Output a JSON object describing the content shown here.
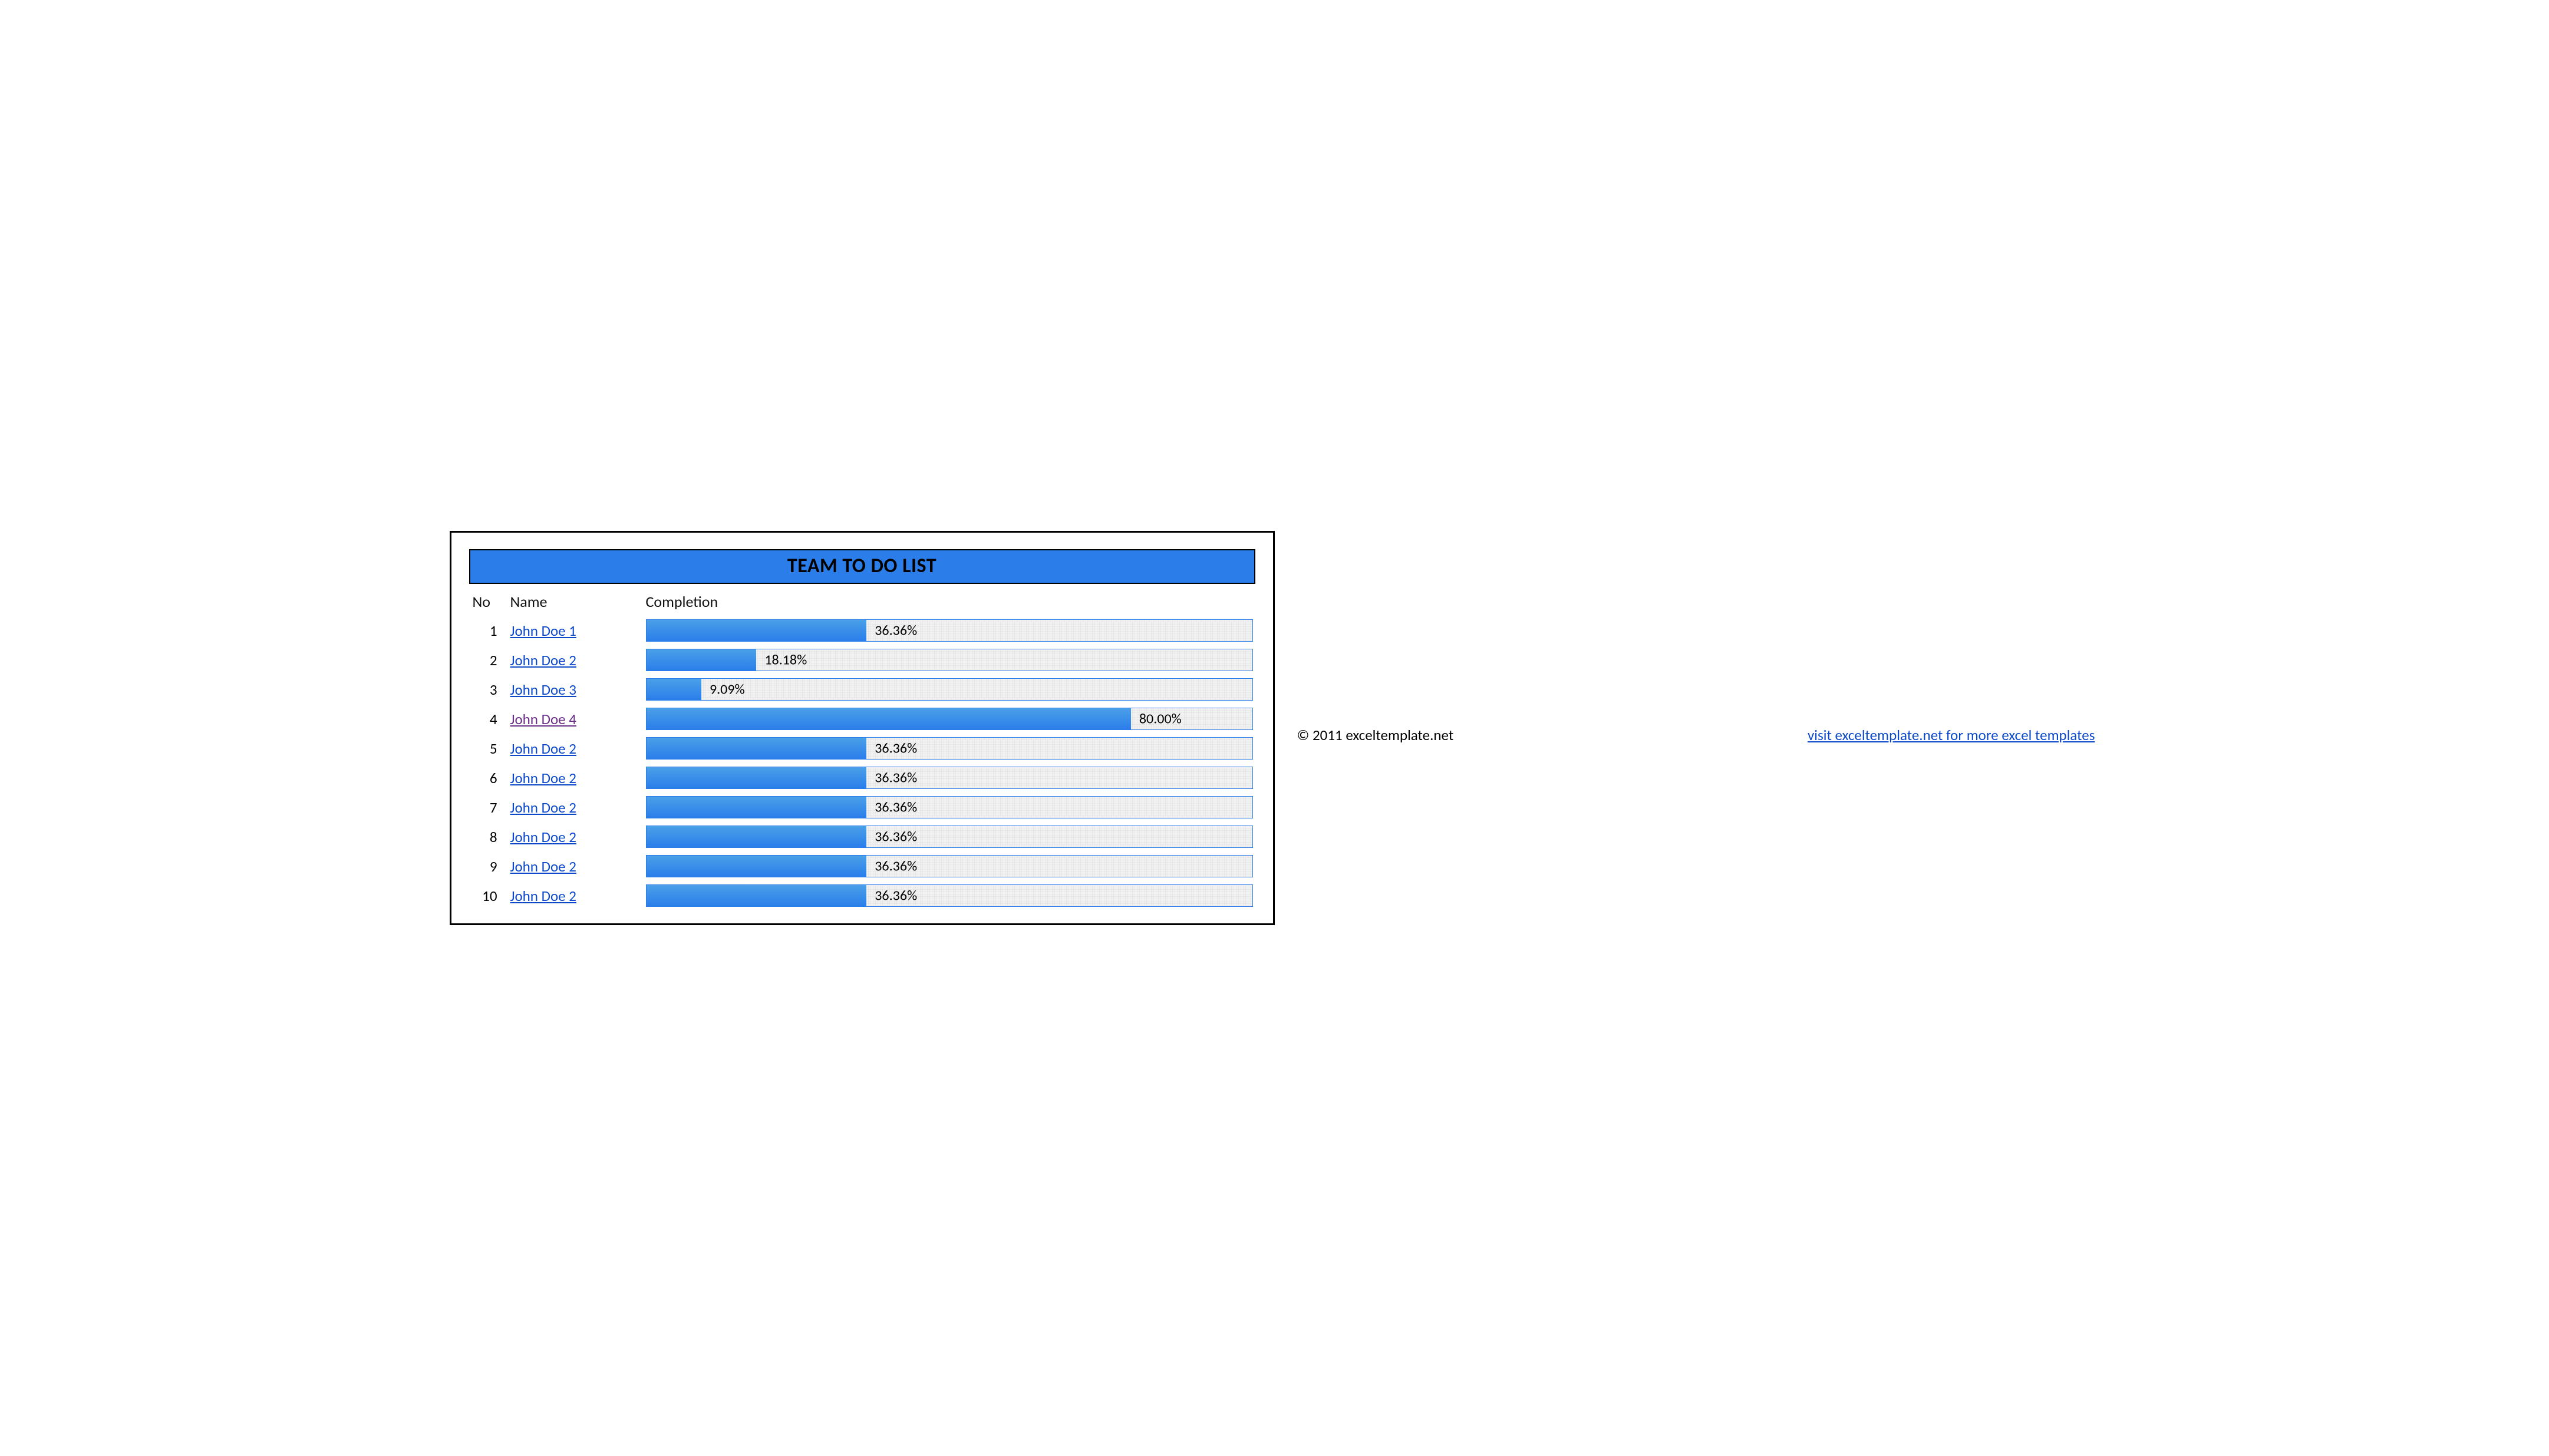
{
  "title": "TEAM TO DO LIST",
  "headers": {
    "no": "No",
    "name": "Name",
    "completion": "Completion"
  },
  "rows": [
    {
      "no": "1",
      "name": "John Doe 1",
      "pct": 36.36,
      "label": "36.36%",
      "visited": false
    },
    {
      "no": "2",
      "name": "John Doe 2",
      "pct": 18.18,
      "label": "18.18%",
      "visited": false
    },
    {
      "no": "3",
      "name": "John Doe 3",
      "pct": 9.09,
      "label": "9.09%",
      "visited": false
    },
    {
      "no": "4",
      "name": "John Doe 4",
      "pct": 80.0,
      "label": "80.00%",
      "visited": true
    },
    {
      "no": "5",
      "name": "John Doe 2",
      "pct": 36.36,
      "label": "36.36%",
      "visited": false
    },
    {
      "no": "6",
      "name": "John Doe 2",
      "pct": 36.36,
      "label": "36.36%",
      "visited": false
    },
    {
      "no": "7",
      "name": "John Doe 2",
      "pct": 36.36,
      "label": "36.36%",
      "visited": false
    },
    {
      "no": "8",
      "name": "John Doe 2",
      "pct": 36.36,
      "label": "36.36%",
      "visited": false
    },
    {
      "no": "9",
      "name": "John Doe 2",
      "pct": 36.36,
      "label": "36.36%",
      "visited": false
    },
    {
      "no": "10",
      "name": "John Doe 2",
      "pct": 36.36,
      "label": "36.36%",
      "visited": false
    }
  ],
  "footer": {
    "copyright": "© 2011 exceltemplate.net",
    "link_text": "visit exceltemplate.net for more excel templates"
  },
  "colors": {
    "accent": "#2b7eea",
    "link": "#0b49c9",
    "visited": "#6b2f8a"
  },
  "chart_data": {
    "type": "bar",
    "orientation": "horizontal",
    "title": "TEAM TO DO LIST",
    "xlabel": "Completion",
    "ylabel": "Name",
    "xlim": [
      0,
      100
    ],
    "categories": [
      "John Doe 1",
      "John Doe 2",
      "John Doe 3",
      "John Doe 4",
      "John Doe 2",
      "John Doe 2",
      "John Doe 2",
      "John Doe 2",
      "John Doe 2",
      "John Doe 2"
    ],
    "values": [
      36.36,
      18.18,
      9.09,
      80.0,
      36.36,
      36.36,
      36.36,
      36.36,
      36.36,
      36.36
    ]
  }
}
